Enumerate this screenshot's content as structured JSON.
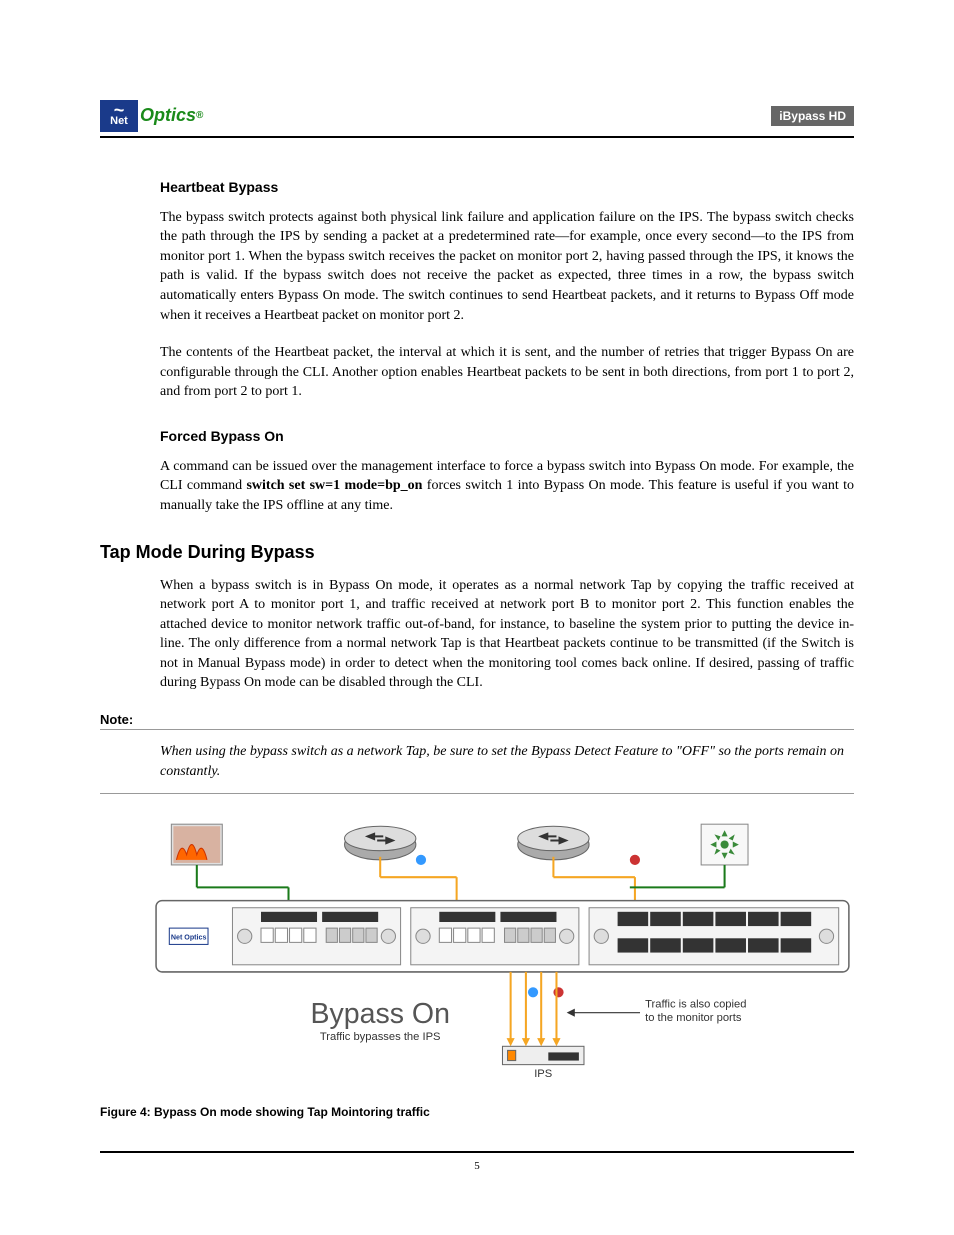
{
  "header": {
    "logo_net": "Net",
    "logo_optics": "Optics",
    "logo_reg": "®",
    "product": "iBypass HD"
  },
  "sections": {
    "heartbeat_heading": "Heartbeat Bypass",
    "heartbeat_p1": "The bypass switch protects against both physical link failure and application failure on the IPS. The bypass switch checks the path through the IPS by sending a packet at a predetermined rate—for example, once every second—to the IPS from monitor port 1. When the bypass switch receives the packet on monitor port 2, having passed through the IPS, it knows the path is valid. If the bypass switch does not receive the packet as expected, three times in a row, the bypass switch automatically enters Bypass On mode. The switch continues to send Heartbeat packets, and it returns to Bypass Off mode when it receives a Heartbeat packet on monitor port 2.",
    "heartbeat_p2": "The contents of the Heartbeat packet, the interval at which it is sent, and the number of retries that trigger Bypass On are configurable through the CLI. Another option enables Heartbeat packets to be sent in both directions, from port 1 to port 2, and from port 2 to port 1.",
    "forced_heading": "Forced Bypass On",
    "forced_p1_a": "A command can be issued over the management interface to force a bypass switch into Bypass On mode. For example, the CLI command  ",
    "forced_cmd": "switch set sw=1 mode=bp_on",
    "forced_p1_b": " forces switch 1 into Bypass On mode. This feature is useful if you want to manually take the IPS offline at any time.",
    "tap_heading": "Tap Mode During Bypass",
    "tap_p1": "When a bypass switch is in Bypass On mode, it operates as a normal network Tap by copying the traffic received at network port A to monitor port 1, and traffic received at network port B to monitor port 2. This function enables the attached device to monitor network traffic out-of-band, for instance, to baseline the system prior to putting the device in-line. The only difference from a normal network Tap is that Heartbeat packets continue to be transmitted (if the Switch is not in Manual Bypass mode) in order to detect when the monitoring tool comes back online. If desired, passing of traffic during Bypass On mode can be disabled through the CLI.",
    "note_label": "Note:",
    "note_text": " When using the bypass switch as a network Tap, be sure to set the Bypass Detect Feature to \"OFF\" so the ports remain on constantly."
  },
  "figure": {
    "bypass_title": "Bypass On",
    "bypass_subtitle": "Traffic bypasses the IPS",
    "traffic_note_line1": "Traffic is also copied",
    "traffic_note_line2": "to the monitor ports",
    "ips_label": "IPS",
    "device_logo": "Net Optics",
    "caption": "Figure 4: Bypass On mode showing Tap Mointoring traffic"
  },
  "footer": {
    "page": "5"
  }
}
